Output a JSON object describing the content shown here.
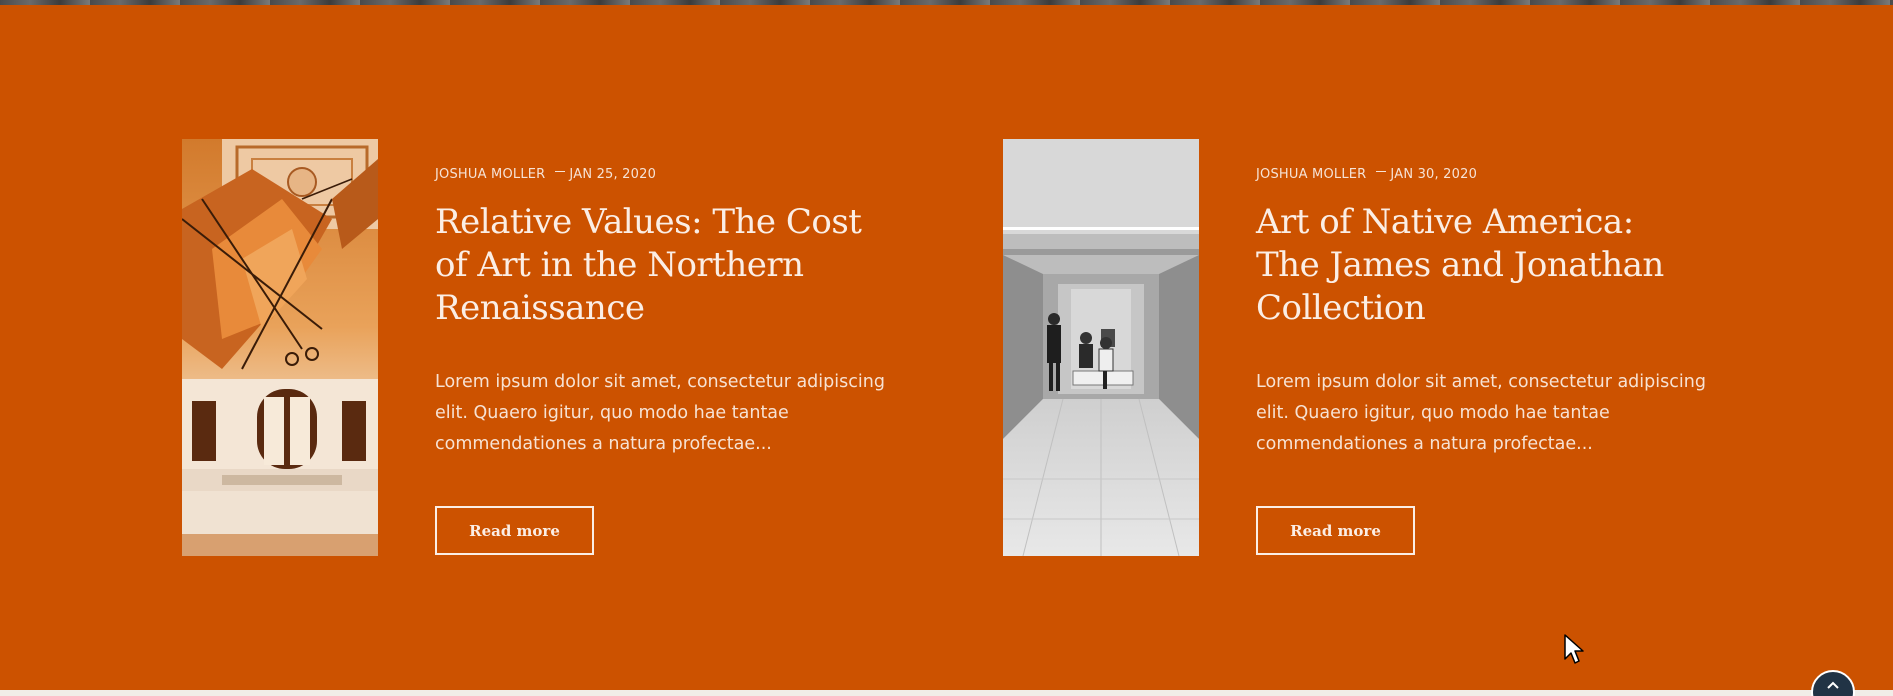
{
  "colors": {
    "background": "#cc5200",
    "text": "#fbeee5",
    "scroll_button": "#213345"
  },
  "posts": [
    {
      "author": "JOSHUA MOLLER",
      "date": "JAN 25, 2020",
      "title": "Relative Values: The Cost of Art in the Northern Renaissance",
      "excerpt": "Lorem ipsum dolor sit amet, consectetur adipiscing elit. Quaero igitur, quo modo hae tantae commendationes a natura profectae...",
      "button_label": "Read more",
      "image": "museum-ceiling-flying-machine-photo"
    },
    {
      "author": "JOSHUA MOLLER",
      "date": "JAN 30, 2020",
      "title": "Art of Native America: The James and Jonathan Collection",
      "excerpt": "Lorem ipsum dolor sit amet, consectetur adipiscing elit. Quaero igitur, quo modo hae tantae commendationes a natura profectae...",
      "button_label": "Read more",
      "image": "gallery-hallway-visitors-photo"
    }
  ],
  "scroll_top": {
    "icon": "chevron-up-icon"
  }
}
